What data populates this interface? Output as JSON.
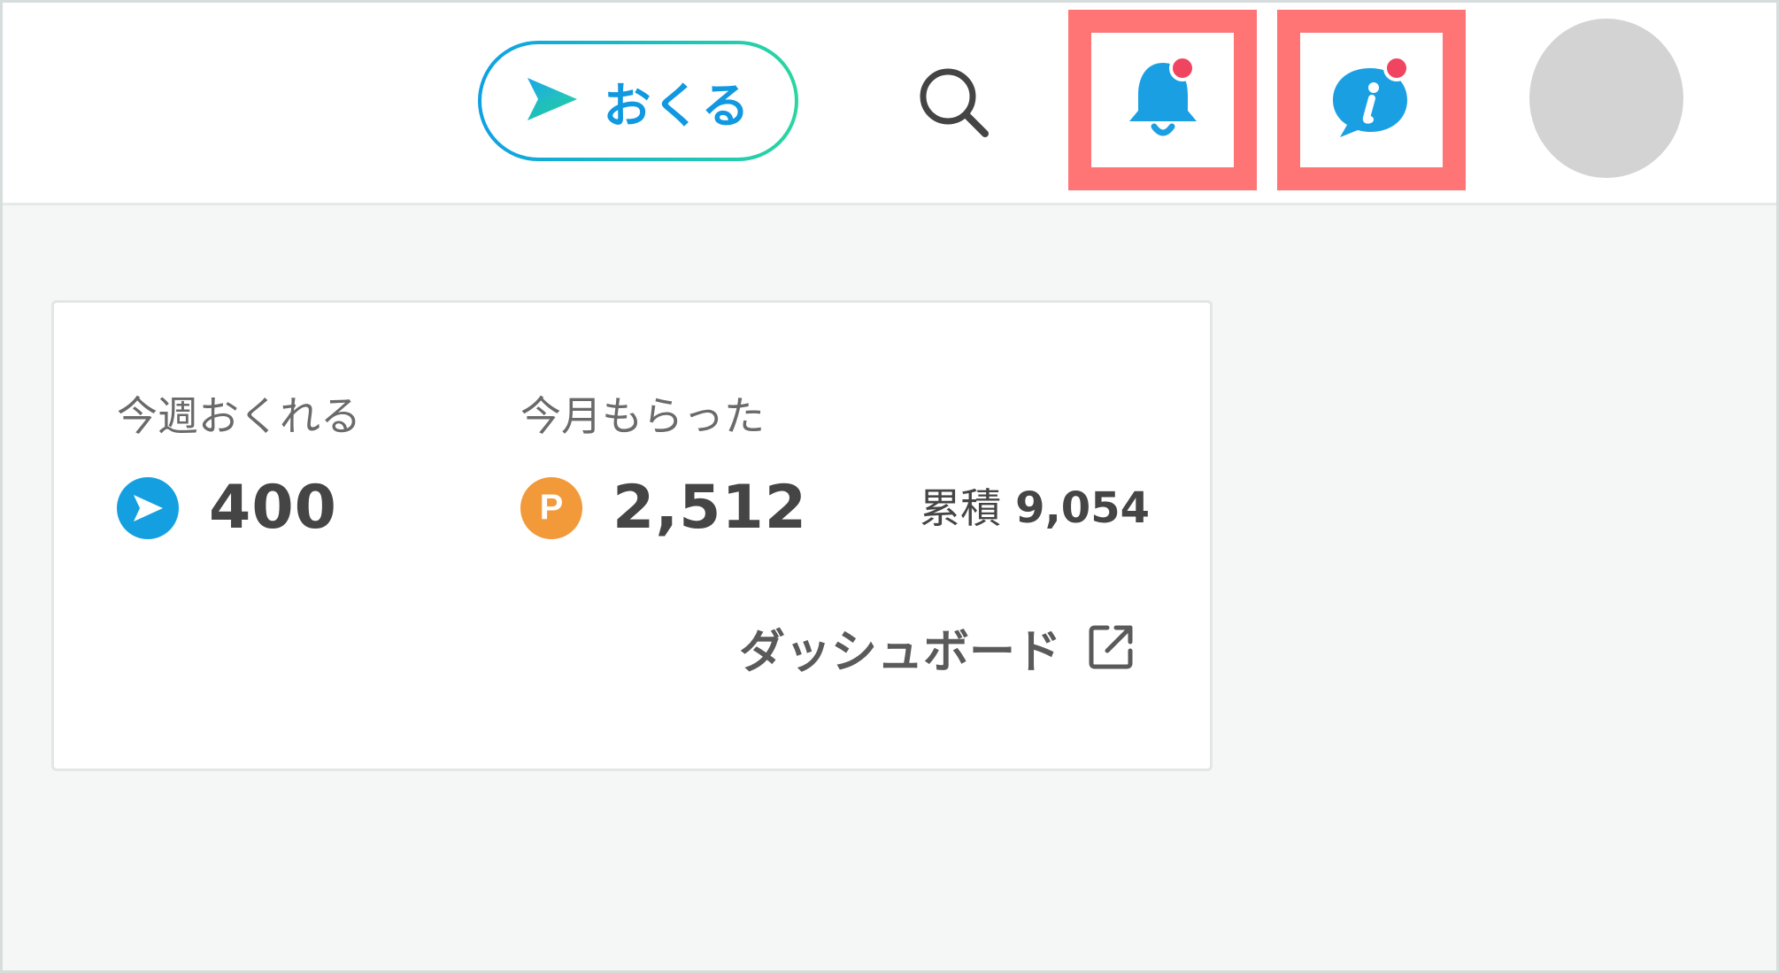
{
  "header": {
    "send_button": {
      "label": "おくる",
      "icon": "paper-plane-icon"
    },
    "search": {
      "icon": "search-icon"
    },
    "notifications": {
      "icon": "bell-icon",
      "has_unread": true
    },
    "info": {
      "icon": "info-chat-icon",
      "has_unread": true
    },
    "avatar": {
      "icon": "avatar"
    }
  },
  "summary": {
    "sendable_this_week": {
      "label": "今週おくれる",
      "value": "400",
      "icon": "send-coin-icon"
    },
    "received_this_month": {
      "label": "今月もらった",
      "value": "2,512",
      "icon": "point-coin-icon",
      "coin_letter": "P"
    },
    "cumulative": {
      "label": "累積",
      "value": "9,054"
    },
    "dashboard_link": {
      "label": "ダッシュボード",
      "icon": "external-link-icon"
    }
  },
  "colors": {
    "accent_blue": "#1098e0",
    "accent_green": "#2ad6a0",
    "highlight": "#ff7474",
    "badge_red": "#f04560",
    "point_orange": "#f2993a",
    "avatar_gray": "#d2d3d2"
  }
}
